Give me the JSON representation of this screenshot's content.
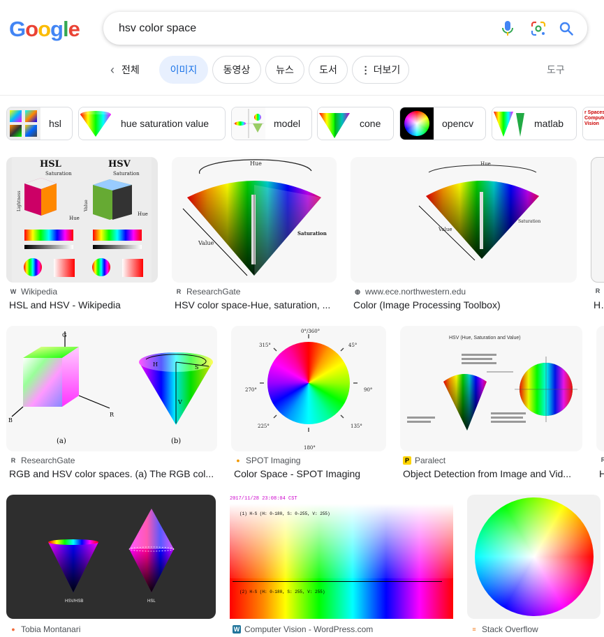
{
  "logo": {
    "letters": [
      "G",
      "o",
      "o",
      "g",
      "l",
      "e"
    ],
    "colors": [
      "#4285F4",
      "#EA4335",
      "#FBBC05",
      "#4285F4",
      "#34A853",
      "#EA4335"
    ]
  },
  "search": {
    "query": "hsv color space",
    "mic_icon": "mic-icon",
    "lens_icon": "lens-icon",
    "search_icon": "search-icon"
  },
  "tabs": {
    "all": "전체",
    "images": "이미지",
    "videos": "동영상",
    "news": "뉴스",
    "books": "도서",
    "more": "더보기",
    "tools": "도구"
  },
  "chips": [
    {
      "label": "hsl"
    },
    {
      "label": "hue saturation value"
    },
    {
      "label": "model"
    },
    {
      "label": "cone"
    },
    {
      "label": "opencv"
    },
    {
      "label": "matlab"
    }
  ],
  "chip_thumb_text": "r Spaces in Computer Vision",
  "results": [
    {
      "source": "Wikipedia",
      "fav": "W",
      "title": "HSL and HSV - Wikipedia",
      "img_text": {
        "hsl": "HSL",
        "hsv": "HSV",
        "saturation": "Saturation",
        "hue": "Hue",
        "lightness": "Lightness",
        "value": "Value"
      }
    },
    {
      "source": "ResearchGate",
      "fav": "R",
      "title": "HSV color space-Hue, saturation, ...",
      "img_text": {
        "hue": "Hue",
        "value": "Value",
        "saturation": "Saturation"
      }
    },
    {
      "source": "www.ece.northwestern.edu",
      "fav": "◍",
      "title": "Color (Image Processing Toolbox)",
      "img_text": {
        "hue": "Hue",
        "value": "Value",
        "saturation": "Saturation"
      }
    },
    {
      "source": "R",
      "fav": "R",
      "title": "HS",
      "img_text": {}
    },
    {
      "source": "ResearchGate",
      "fav": "R",
      "title": "RGB and HSV color spaces. (a) The RGB col...",
      "img_text": {
        "a": "(a)",
        "b": "(b)",
        "g": "G",
        "r": "R",
        "bl": "B",
        "h": "H",
        "s": "S",
        "v": "V"
      }
    },
    {
      "source": "SPOT Imaging",
      "fav": "●",
      "title": "Color Space - SPOT Imaging",
      "img_text": {
        "top": "0°/360°",
        "d45": "45°",
        "d90": "90°",
        "d135": "135°",
        "d180": "180°",
        "d225": "225°",
        "d270": "270°",
        "d315": "315°"
      }
    },
    {
      "source": "Paralect",
      "fav": "P",
      "title": "Object Detection from Image and Vid...",
      "img_text": {
        "heading": "HSV (Hue, Saturation and Value)"
      }
    },
    {
      "source": "R",
      "fav": "R",
      "title": "H",
      "img_text": {}
    },
    {
      "source": "Tobia Montanari",
      "fav": "●",
      "title": "",
      "img_text": {
        "hsvhsb": "HSV/HSB",
        "hsl": "HSL"
      }
    },
    {
      "source": "Computer Vision - WordPress.com",
      "fav": "W",
      "title": "",
      "img_text": {
        "timestamp": "2017/11/28 23:08:04 CST",
        "line1": "(1) H-S (H: 0-180, S: 0-255, V: 255)",
        "line2": "(2) H-S (H: 0-180, S: 255, V: 255)"
      }
    },
    {
      "source": "Stack Overflow",
      "fav": "≡",
      "title": "",
      "img_text": {}
    }
  ]
}
